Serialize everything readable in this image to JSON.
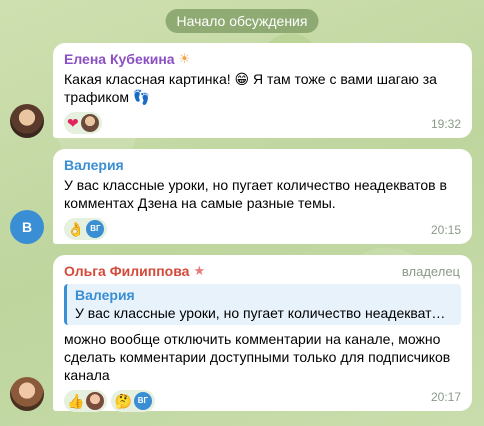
{
  "date_pill": "Начало обсуждения",
  "colors": {
    "elena": "#8b4fc4",
    "valeria": "#3a8ed4",
    "olga": "#d44a3a"
  },
  "messages": [
    {
      "sender": "Елена Кубекина",
      "sender_badge_icon": "sun-icon",
      "text": "Какая классная картинка! 😁 Я там тоже с вами шагаю за трафиком 👣",
      "reactions": [
        {
          "emoji": "❤️",
          "avatar": "photo"
        }
      ],
      "time": "19:32"
    },
    {
      "sender": "Валерия",
      "avatar_letter": "В",
      "text": "У вас классные уроки, но пугает количество неадекватов в комментах Дзена на самые разные темы.",
      "reactions": [
        {
          "emoji": "👌",
          "avatar_text": "ВГ"
        }
      ],
      "time": "20:15"
    },
    {
      "sender": "Ольга Филиппова",
      "sender_badge_icon": "star-icon",
      "role": "владелец",
      "quote_name": "Валерия",
      "quote_text": "У вас классные уроки, но пугает количество неадекватов в ...",
      "text": "можно вообще отключить комментарии на канале, можно сделать комментарии доступными только для подписчиков канала",
      "reactions": [
        {
          "emoji": "👍",
          "avatar": "photo"
        },
        {
          "emoji": "🤔",
          "avatar_text": "ВГ"
        }
      ],
      "time": "20:17"
    }
  ]
}
